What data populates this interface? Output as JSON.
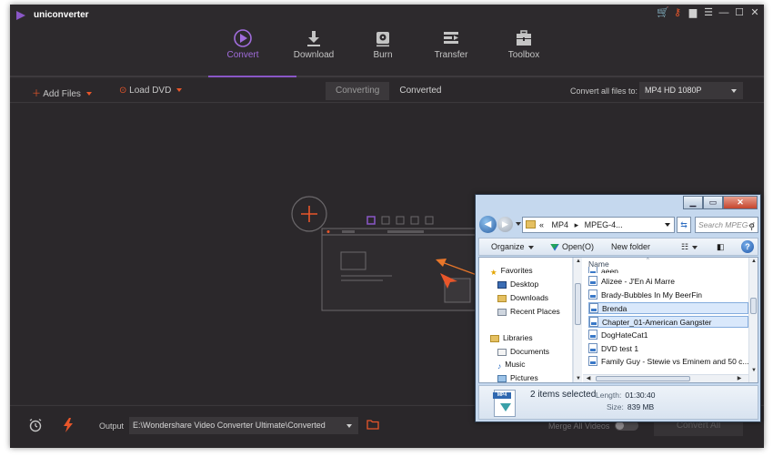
{
  "app": {
    "title": "uniconverter",
    "accent": "#8a57c7",
    "orange": "#e8562a"
  },
  "nav": [
    {
      "label": "Convert",
      "icon": "convert-icon",
      "active": true
    },
    {
      "label": "Download",
      "icon": "download-icon",
      "active": false
    },
    {
      "label": "Burn",
      "icon": "burn-icon",
      "active": false
    },
    {
      "label": "Transfer",
      "icon": "transfer-icon",
      "active": false
    },
    {
      "label": "Toolbox",
      "icon": "toolbox-icon",
      "active": false
    }
  ],
  "toolbar": {
    "add_files": "Add Files",
    "load_dvd": "Load DVD",
    "tab_converting": "Converting",
    "tab_converted": "Converted",
    "convert_all_label": "Convert all files to:",
    "format_value": "MP4 HD 1080P"
  },
  "bottom": {
    "output_label": "Output",
    "output_path": "E:\\Wondershare Video Converter Ultimate\\Converted",
    "merge_label": "Merge All Videos",
    "convert_all_button": "Convert All"
  },
  "explorer": {
    "path_sep": "«",
    "path_1": "MP4",
    "path_2": "MPEG-4...",
    "search_placeholder": "Search MPEG-4 ...",
    "organize": "Organize",
    "open": "Open(O)",
    "new_folder": "New folder",
    "nav_items": [
      {
        "label": "Favorites",
        "icon": "star-icon"
      },
      {
        "label": "Desktop",
        "icon": "desktop-icon"
      },
      {
        "label": "Downloads",
        "icon": "downloads-icon"
      },
      {
        "label": "Recent Places",
        "icon": "recent-places-icon"
      },
      {
        "label": "Libraries",
        "icon": "libraries-icon"
      },
      {
        "label": "Documents",
        "icon": "documents-icon"
      },
      {
        "label": "Music",
        "icon": "music-icon"
      },
      {
        "label": "Pictures",
        "icon": "pictures-icon"
      }
    ],
    "column_name": "Name",
    "files": [
      {
        "name": "Alizee - J'En Ai Marre",
        "selected": false
      },
      {
        "name": "Brady-Bubbles In My BeerFin",
        "selected": false
      },
      {
        "name": "Brenda",
        "selected": true
      },
      {
        "name": "Chapter_01-American Gangster",
        "selected": true
      },
      {
        "name": "DogHateCat1",
        "selected": false
      },
      {
        "name": "DVD test 1",
        "selected": false
      },
      {
        "name": "Family Guy - Stewie vs Eminem and 50 c...",
        "selected": false
      }
    ],
    "file_partial": "aeep",
    "selection_text": "2 items selected",
    "length_label": "Length:",
    "length_value": "01:30:40",
    "size_label": "Size:",
    "size_value": "839 MB",
    "file_type_badge": "MP4"
  }
}
